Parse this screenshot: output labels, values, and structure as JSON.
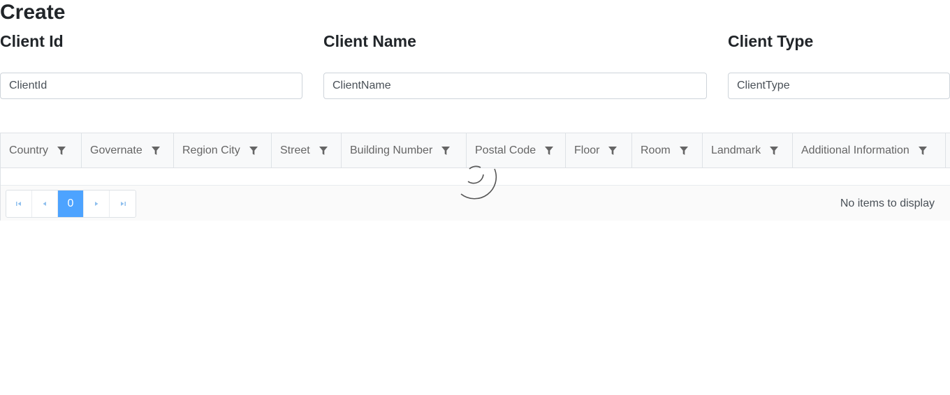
{
  "page": {
    "title": "Create"
  },
  "fields": {
    "client_id": {
      "label": "Client Id",
      "placeholder": "ClientId"
    },
    "client_name": {
      "label": "Client Name",
      "placeholder": "ClientName"
    },
    "client_type": {
      "label": "Client Type",
      "placeholder": "ClientType"
    }
  },
  "grid": {
    "columns": [
      {
        "label": "Country"
      },
      {
        "label": "Governate"
      },
      {
        "label": "Region City"
      },
      {
        "label": "Street"
      },
      {
        "label": "Building Number"
      },
      {
        "label": "Postal Code"
      },
      {
        "label": "Floor"
      },
      {
        "label": "Room"
      },
      {
        "label": "Landmark"
      },
      {
        "label": "Additional Information"
      }
    ],
    "pager": {
      "current_page": "0",
      "info": "No items to display"
    }
  },
  "icons": {
    "filter": "filter-icon",
    "first": "first-page-icon",
    "prev": "previous-page-icon",
    "next": "next-page-icon",
    "last": "last-page-icon",
    "loading": "loading-spinner-icon"
  },
  "colors": {
    "accent": "#4da3ff",
    "header_bg": "#f8f9fa",
    "pager_bg": "#fafafa"
  }
}
